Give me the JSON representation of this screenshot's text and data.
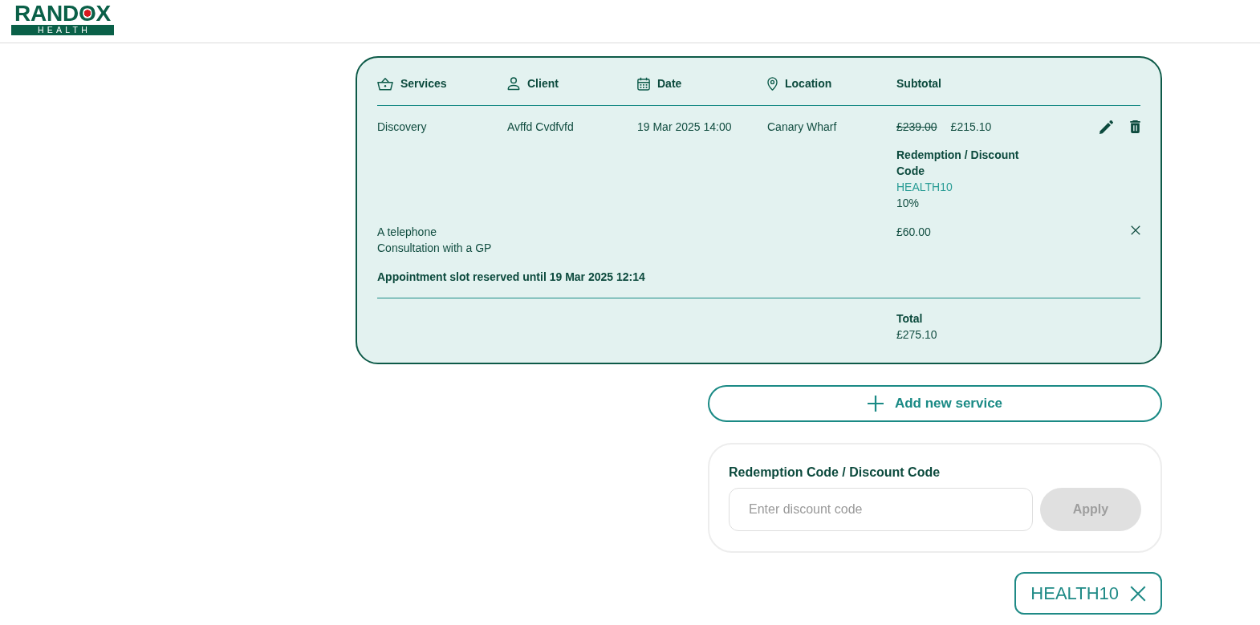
{
  "header": {
    "logo": {
      "wordmark": "RANDOX",
      "tagline": "HEALTH"
    }
  },
  "basket": {
    "columns": [
      {
        "label": "Services"
      },
      {
        "label": "Client"
      },
      {
        "label": "Date"
      },
      {
        "label": "Location"
      },
      {
        "label": "Subtotal"
      }
    ],
    "items": [
      {
        "kind": "booking",
        "service": "Discovery",
        "client": "Avffd Cvdfvfd",
        "date": "19 Mar 2025 14:00",
        "location": "Canary Wharf",
        "original_price": "£239.00",
        "price": "£215.10",
        "discount": {
          "label": "Redemption / Discount Code",
          "code": "HEALTH10",
          "amount": "10%"
        }
      },
      {
        "kind": "addon",
        "service": "A telephone Consultation with a GP",
        "price": "£60.00"
      }
    ],
    "reservation_notice": "Appointment slot reserved until 19 Mar 2025 12:14",
    "total": {
      "label": "Total",
      "value": "£275.10"
    }
  },
  "add_service_button": {
    "label": "Add new service"
  },
  "discount_form": {
    "title": "Redemption Code / Discount Code",
    "input": {
      "placeholder": "Enter discount code"
    },
    "apply_button": {
      "label": "Apply",
      "disabled": true
    }
  },
  "applied_codes": [
    {
      "code": "HEALTH10"
    }
  ]
}
